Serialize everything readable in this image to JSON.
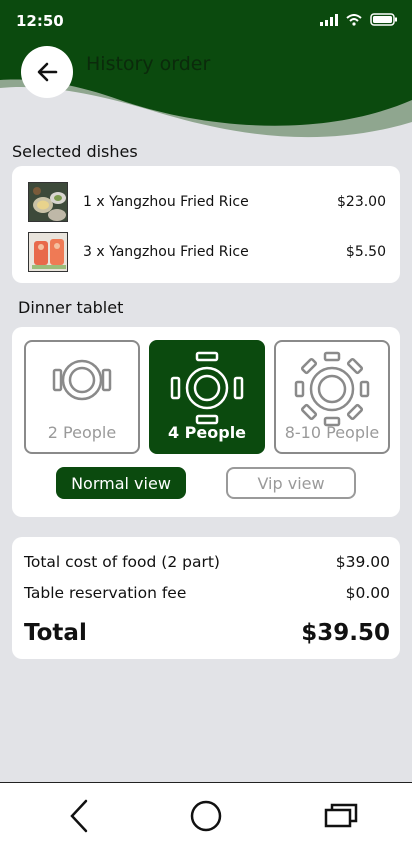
{
  "status_bar": {
    "time": "12:50"
  },
  "header": {
    "title": "History order"
  },
  "selected_dishes": {
    "label": "Selected dishes",
    "items": [
      {
        "name": "1 x Yangzhou Fried Rice",
        "price": "$23.00"
      },
      {
        "name": "3 x Yangzhou Fried Rice",
        "price": "$5.50"
      }
    ]
  },
  "dinner_table": {
    "label": "Dinner tablet",
    "options": [
      {
        "label": "2 People",
        "selected": false
      },
      {
        "label": "4 People",
        "selected": true
      },
      {
        "label": "8-10 People",
        "selected": false
      }
    ],
    "views": {
      "normal": "Normal view",
      "vip": "Vip view"
    }
  },
  "summary": {
    "food_label": "Total cost of food (2 part)",
    "food_value": "$39.00",
    "fee_label": "Table reservation fee",
    "fee_value": "$0.00",
    "total_label": "Total",
    "total_value": "$39.50"
  },
  "colors": {
    "brand": "#0b4a0e",
    "background": "#e2e3e7"
  }
}
